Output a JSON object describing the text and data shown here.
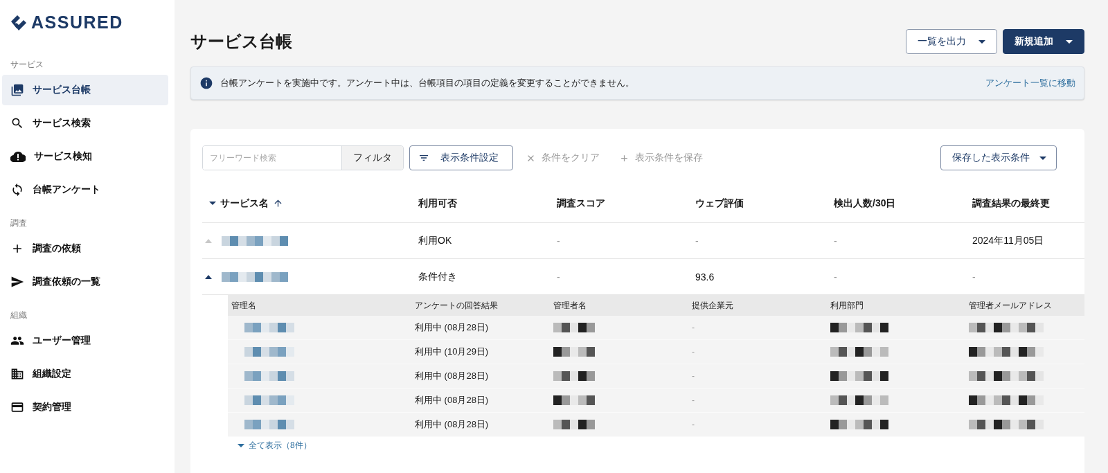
{
  "logo": {
    "text": "ASSURED"
  },
  "sidebar": {
    "groups": [
      {
        "heading": "サービス",
        "items": [
          {
            "label": "サービス台帳",
            "selected": true
          },
          {
            "label": "サービス検索",
            "selected": false
          },
          {
            "label": "サービス検知",
            "selected": false
          },
          {
            "label": "台帳アンケート",
            "selected": false
          }
        ]
      },
      {
        "heading": "調査",
        "items": [
          {
            "label": "調査の依頼",
            "selected": false
          },
          {
            "label": "調査依頼の一覧",
            "selected": false
          }
        ]
      },
      {
        "heading": "組織",
        "items": [
          {
            "label": "ユーザー管理",
            "selected": false
          },
          {
            "label": "組織設定",
            "selected": false
          },
          {
            "label": "契約管理",
            "selected": false
          }
        ]
      }
    ]
  },
  "page": {
    "title": "サービス台帳",
    "buttons": [
      {
        "label": "一覧を出力",
        "kind": "outline"
      },
      {
        "label": "新規追加",
        "kind": "primary"
      }
    ]
  },
  "notice": {
    "message": "台帳アンケートを実施中です。アンケート中は、台帳項目の項目の定義を変更することができません。",
    "link": "アンケート一覧に移動"
  },
  "toolbar": {
    "search": {
      "placeholder": "フリーワード検索"
    },
    "filter_button": "フィルタ",
    "settings_button": "表示条件設定",
    "actions": [
      {
        "label": "条件をクリア",
        "kind": "clear",
        "disabled": true
      },
      {
        "label": "表示条件を保存",
        "kind": "save",
        "disabled": true
      }
    ],
    "saved_button": "保存した表示条件"
  },
  "table": {
    "columns": [
      "サービス名",
      "利用可否",
      "調査スコア",
      "ウェブ評価",
      "検出人数/30日",
      "調査結果の最終更"
    ],
    "rows": [
      {
        "expanded": false,
        "cells": [
          "",
          "利用OK",
          "-",
          "-",
          "-",
          "2024年11月05日"
        ]
      },
      {
        "expanded": true,
        "cells": [
          "",
          "条件付き",
          "-",
          "93.6",
          "-",
          "-"
        ]
      }
    ],
    "sub_table": {
      "columns": [
        "管理名",
        "アンケートの回答結果",
        "管理者名",
        "提供企業元",
        "利用部門",
        "管理者メールアドレス"
      ],
      "rows": [
        {
          "answer": "利用中 (08月28日)",
          "provider": "-"
        },
        {
          "answer": "利用中 (10月29日)",
          "provider": "-"
        },
        {
          "answer": "利用中 (08月28日)",
          "provider": "-"
        },
        {
          "answer": "利用中 (08月28日)",
          "provider": "-"
        },
        {
          "answer": "利用中 (08月28日)",
          "provider": "-"
        }
      ],
      "show_all": "全て表示（8件）"
    }
  }
}
